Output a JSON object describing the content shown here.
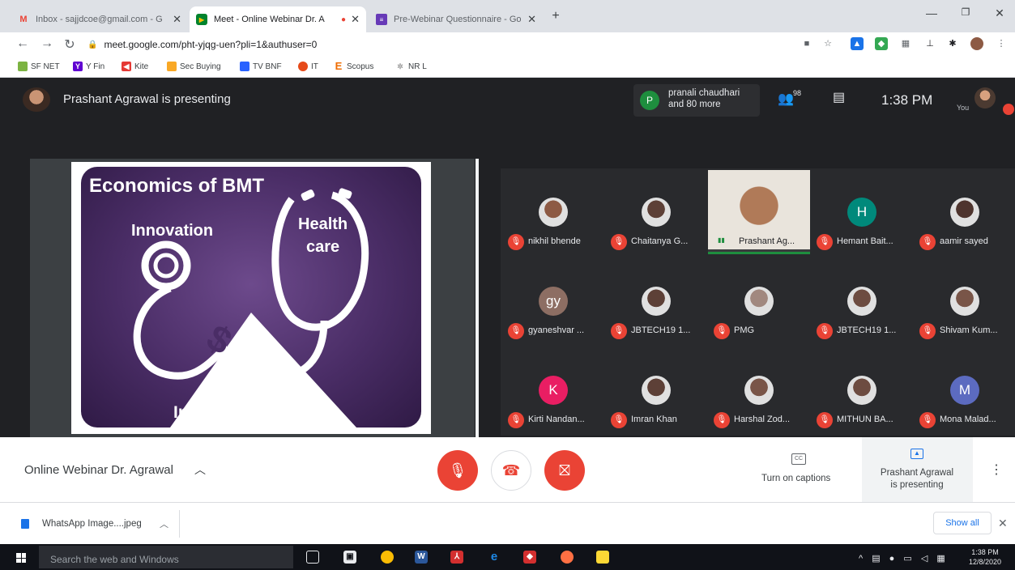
{
  "browser": {
    "tabs": [
      {
        "title": "Inbox - sajjdcoe@gmail.com - G",
        "favicon": "gmail-icon"
      },
      {
        "title": "Meet - Online Webinar Dr. A",
        "favicon": "meet-icon"
      },
      {
        "title": "Pre-Webinar Questionnaire - Go",
        "favicon": "forms-icon"
      }
    ],
    "new_tab": "+",
    "url": "meet.google.com/pht-yjqg-uen?pli=1&authuser=0",
    "bookmarks": [
      "SF NET",
      "Y Fin",
      "Kite",
      "Sec Buying",
      "TV BNF",
      "IT",
      "Scopus",
      "NR L"
    ]
  },
  "meet": {
    "presenting_text": "Prashant Agrawal is presenting",
    "people_chip": {
      "avatar_letter": "P",
      "text": "pranali chaudhari and 80 more"
    },
    "people_count": "98",
    "clock": "1:38 PM",
    "you_label": "You",
    "slide": {
      "title": "Economics of BMT",
      "innovation": "Innovation",
      "health": "Health",
      "care": "care",
      "dollar": "$",
      "bottom": "Insurance / Cost"
    },
    "participants": [
      {
        "name": "nikhil bhende",
        "type": "photo"
      },
      {
        "name": "Chaitanya G...",
        "type": "photo"
      },
      {
        "name": "Prashant Ag...",
        "type": "speaker"
      },
      {
        "name": "Hemant Bait...",
        "type": "letter",
        "letter": "H",
        "color": "#00897b"
      },
      {
        "name": "aamir sayed",
        "type": "photo"
      },
      {
        "name": "gyaneshvar ...",
        "type": "letter",
        "letter": "gy",
        "color": "#8d6e63"
      },
      {
        "name": "JBTECH19 1...",
        "type": "photo"
      },
      {
        "name": "PMG",
        "type": "photo"
      },
      {
        "name": "JBTECH19 1...",
        "type": "photo"
      },
      {
        "name": "Shivam Kum...",
        "type": "photo"
      },
      {
        "name": "Kirti Nandan...",
        "type": "letter",
        "letter": "K",
        "color": "#e91e63"
      },
      {
        "name": "Imran Khan",
        "type": "photo"
      },
      {
        "name": "Harshal Zod...",
        "type": "photo"
      },
      {
        "name": "MITHUN BA...",
        "type": "photo"
      },
      {
        "name": "Mona Malad...",
        "type": "letter",
        "letter": "M",
        "color": "#5c6bc0"
      }
    ]
  },
  "bottom": {
    "meeting_title": "Online Webinar Dr. Agrawal",
    "captions": "Turn on captions",
    "presenting_line1": "Prashant Agrawal",
    "presenting_line2": "is presenting"
  },
  "downloads": {
    "file": "WhatsApp Image....jpeg",
    "show_all": "Show all"
  },
  "taskbar": {
    "search": "Search the web and Windows",
    "time": "1:38 PM",
    "date": "12/8/2020"
  },
  "colors": {
    "meet_bg": "#202124",
    "mic_off": "#ea4335",
    "accent": "#1a73e8"
  }
}
